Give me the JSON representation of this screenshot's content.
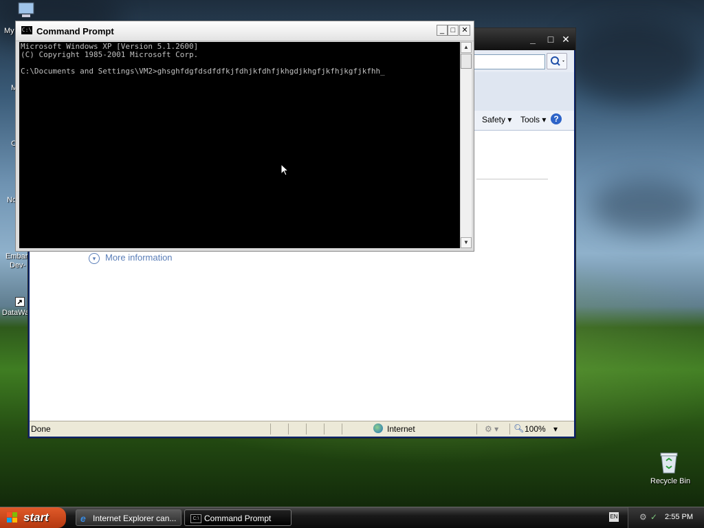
{
  "desktop": {
    "icons": [
      {
        "label": "My"
      },
      {
        "label": "M"
      },
      {
        "label": "C"
      },
      {
        "label": "No"
      },
      {
        "label": "Embar"
      },
      {
        "label": "Dev-"
      },
      {
        "label": "DataWa"
      }
    ],
    "recycle_bin": {
      "label": "Recycle Bin"
    }
  },
  "ie_window": {
    "controls": {
      "minimize": "_",
      "maximize": "□",
      "close": "✕"
    },
    "toolbar": {
      "safety": "Safety ▾",
      "tools": "Tools ▾",
      "help": "?"
    },
    "content": {
      "more_info": "More information"
    },
    "statusbar": {
      "status": "Done",
      "zone": "Internet",
      "zoom": "100%"
    }
  },
  "cmd_window": {
    "title": "Command Prompt",
    "icon_text": "C:\\",
    "controls": {
      "minimize": "_",
      "maximize": "□",
      "close": "✕"
    },
    "lines": [
      "Microsoft Windows XP [Version 5.1.2600]",
      "(C) Copyright 1985-2001 Microsoft Corp.",
      "",
      "C:\\Documents and Settings\\VM2>ghsghfdgfdsdfdfkjfdhjkfdhfjkhgdjkhgfjkfhjkgfjkfhh_"
    ]
  },
  "taskbar": {
    "start": "start",
    "tasks": [
      {
        "label": "Internet Explorer can..."
      },
      {
        "label": "Command Prompt"
      }
    ],
    "lang": "EN",
    "clock": "2:55 PM"
  }
}
